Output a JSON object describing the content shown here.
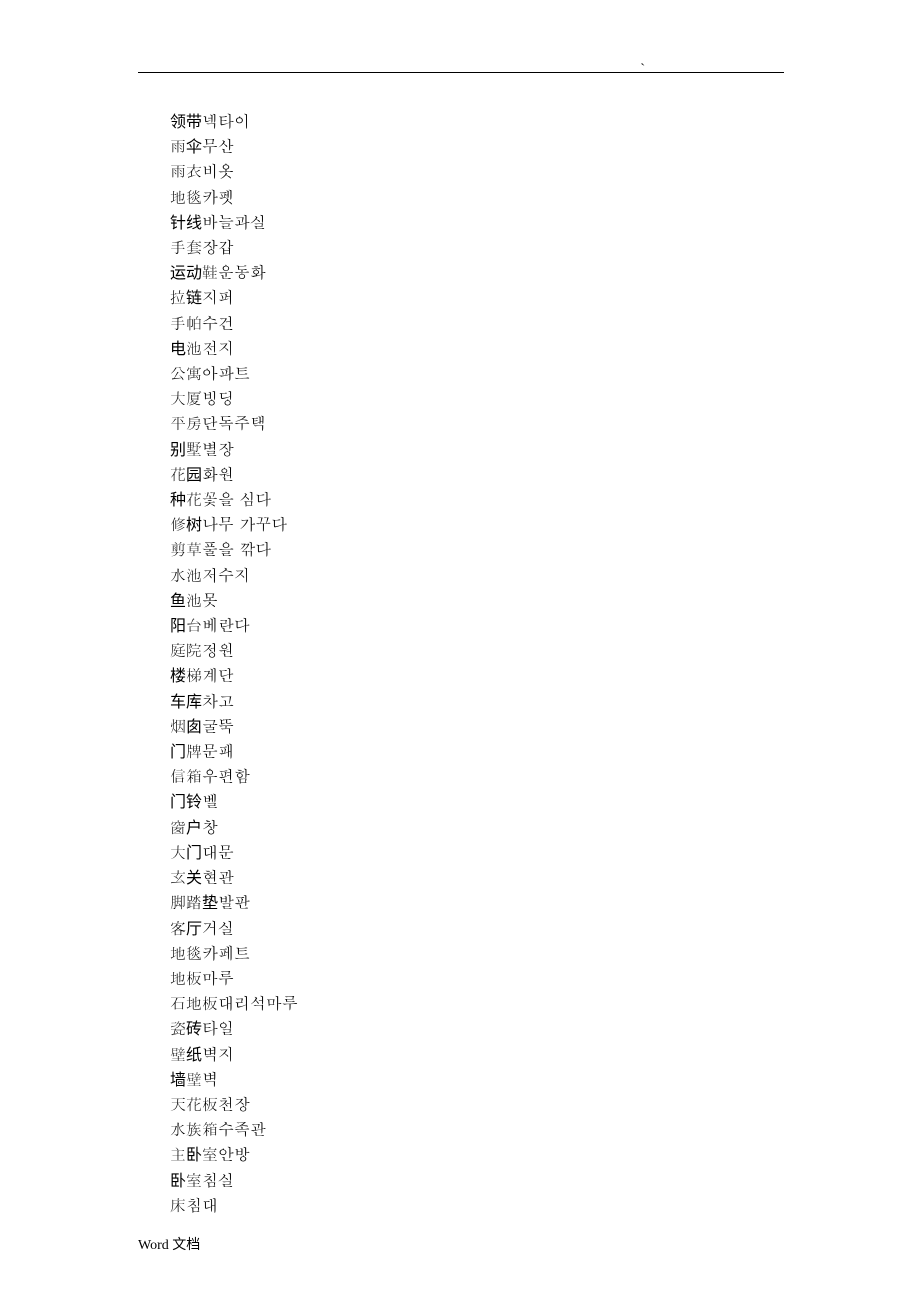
{
  "header": {
    "backtick": "`"
  },
  "lines": [
    "领带넥타이",
    "雨伞무산",
    "雨衣비옷",
    "地毯카펫",
    "针线바늘과실",
    "手套장갑",
    "运动鞋운동화",
    "拉链지퍼",
    "手帕수건",
    "电池전지",
    "公寓아파트",
    "大厦빙딩",
    "平房단독주택",
    "别墅별장",
    "花园화원",
    "种花꽃을 심다",
    "修树나무 가꾸다",
    "剪草풀을 깎다",
    "水池저수지",
    "鱼池못",
    "阳台베란다",
    "庭院정원",
    "楼梯계단",
    "车库차고",
    "烟囱굴뚝",
    "门牌문패",
    "信箱우편함",
    "门铃벨",
    "窗户창",
    "大门대문",
    "玄关현관",
    "脚踏垫발판",
    "客厅거실",
    "地毯카페트",
    "地板마루",
    "石地板대리석마루",
    "瓷砖타일",
    "壁纸벽지",
    "墙壁벽",
    "天花板천장",
    "水族箱수족관",
    "主卧室안방",
    "卧室침실",
    "床침대"
  ],
  "footer": "Word 文档"
}
